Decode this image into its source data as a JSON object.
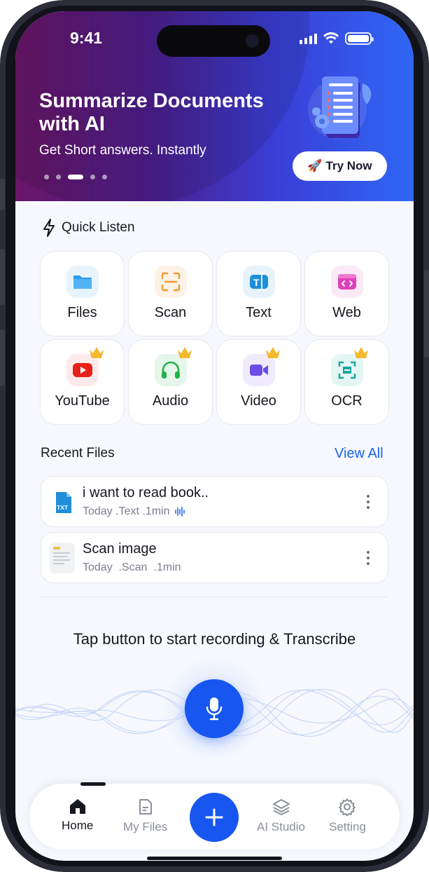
{
  "status_bar": {
    "time": "9:41"
  },
  "banner": {
    "title": "Summarize Documents with AI",
    "subtitle": "Get Short answers. Instantly",
    "cta_label": "Try Now",
    "cta_emoji": "🚀",
    "carousel": {
      "count": 5,
      "active_index": 2
    }
  },
  "quick_listen": {
    "title": "Quick Listen",
    "icon": "lightning-icon",
    "items": [
      {
        "label": "Files",
        "icon": "folder-icon",
        "color": "#2e9bf0",
        "bg": "#e8f4fd",
        "premium": false
      },
      {
        "label": "Scan",
        "icon": "scan-icon",
        "color": "#f29a2e",
        "bg": "#fdf2e6",
        "premium": false
      },
      {
        "label": "Text",
        "icon": "text-icon",
        "color": "#1e8fd8",
        "bg": "#e7f3fb",
        "premium": false
      },
      {
        "label": "Web",
        "icon": "web-icon",
        "color": "#e040b8",
        "bg": "#fbe9f6",
        "premium": false
      },
      {
        "label": "YouTube",
        "icon": "youtube-icon",
        "color": "#e62117",
        "bg": "#fdeaea",
        "premium": true
      },
      {
        "label": "Audio",
        "icon": "headphones-icon",
        "color": "#22b24c",
        "bg": "#e6f6ea",
        "premium": true
      },
      {
        "label": "Video",
        "icon": "video-icon",
        "color": "#6b4de6",
        "bg": "#efebfc",
        "premium": true
      },
      {
        "label": "OCR",
        "icon": "ocr-icon",
        "color": "#16a89a",
        "bg": "#e4f6f4",
        "premium": true
      }
    ]
  },
  "recent_files": {
    "title": "Recent Files",
    "view_all": "View All",
    "items": [
      {
        "name": "i want to read book..",
        "meta": "Today .Text .1min",
        "type": "txt",
        "thumb_label": "TXT",
        "audio_icon": "waveform-icon"
      },
      {
        "name": "Scan image",
        "meta": "Today  .Scan  .1min",
        "type": "scan"
      }
    ]
  },
  "recorder": {
    "prompt": "Tap button to start recording & Transcribe"
  },
  "nav": {
    "items": [
      {
        "label": "Home",
        "icon": "home-icon",
        "active": true
      },
      {
        "label": "My Files",
        "icon": "file-icon",
        "active": false
      },
      {
        "label": "AI Studio",
        "icon": "layers-icon",
        "active": false
      },
      {
        "label": "Setting",
        "icon": "gear-icon",
        "active": false
      }
    ]
  },
  "colors": {
    "accent": "#1757f0",
    "link": "#1a63e9",
    "premium_crown": "#f5b82e"
  }
}
